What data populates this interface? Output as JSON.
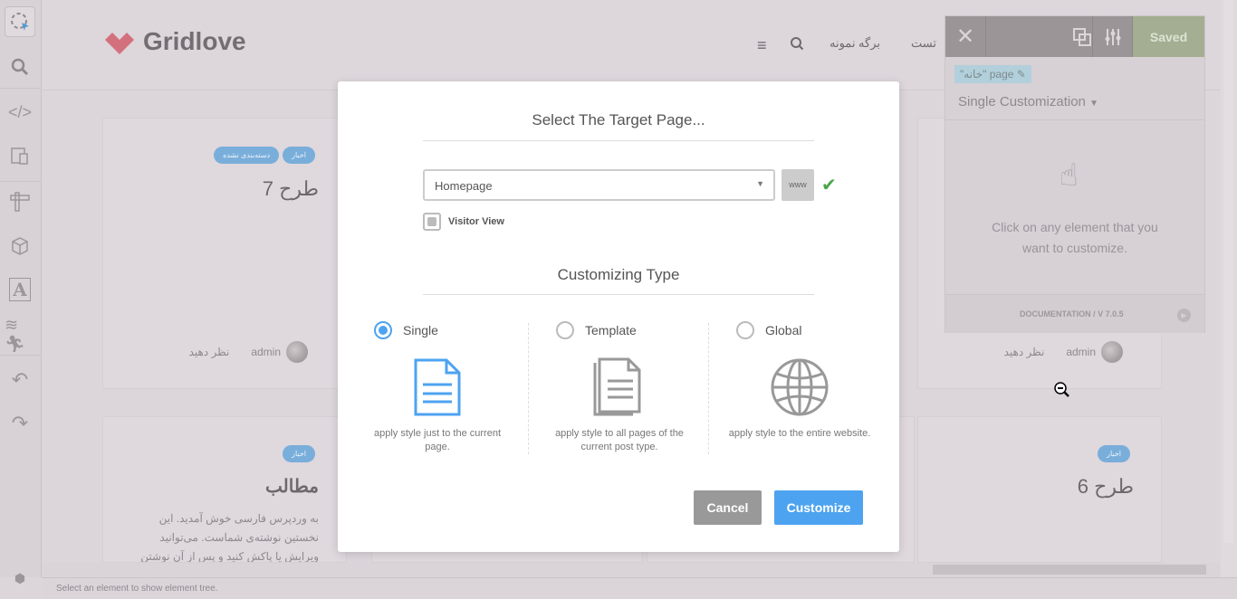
{
  "toolbar": {
    "items": [
      "select-element-icon",
      "search-icon",
      "code-icon",
      "responsive-icon",
      "ruler-icon",
      "box-icon",
      "typography-icon",
      "animation-icon",
      "undo-icon",
      "redo-icon"
    ]
  },
  "site": {
    "logo": "Gridlove",
    "nav": [
      "تست",
      "برگه نمونه"
    ]
  },
  "cards": [
    {
      "tags": [
        "اخبار",
        "دسته‌بندی نشده"
      ],
      "title": "طرح 7",
      "author": "admin",
      "comment": "نظر دهید"
    },
    {
      "author": "admin",
      "comment": "نظر دهید"
    },
    {
      "tags": [
        "اخبار"
      ],
      "title": "مطالب",
      "excerpt": "به وردپرس فارسی خوش آمدید. این نخستین نوشته‌ی شماست. می‌توانید ویرایش یا پاکش کنید و پس از آن نوشتن"
    },
    {
      "tags": [
        "اخبار"
      ],
      "title": "طرح 6"
    }
  ],
  "panel": {
    "saved": "Saved",
    "page_badge": "\"خانه\" page",
    "mode": "Single Customization",
    "hint": "Click on any element that you want to customize.",
    "footer": "DOCUMENTATION / V 7.0.5",
    "saved_color": "#a3ae92"
  },
  "modal": {
    "title": "Select The Target Page...",
    "page_select": "Homepage",
    "www_button": "www",
    "visitor_view": "Visitor View",
    "type_title": "Customizing Type",
    "options": [
      {
        "label": "Single",
        "desc": "apply style just to the current page.",
        "selected": true
      },
      {
        "label": "Template",
        "desc": "apply style to all pages of the current post type.",
        "selected": false
      },
      {
        "label": "Global",
        "desc": "apply style to the entire website.",
        "selected": false
      }
    ],
    "cancel": "Cancel",
    "customize": "Customize",
    "accent": "#4da3f0"
  },
  "statusbar": {
    "text": "Select an element to show element tree."
  }
}
